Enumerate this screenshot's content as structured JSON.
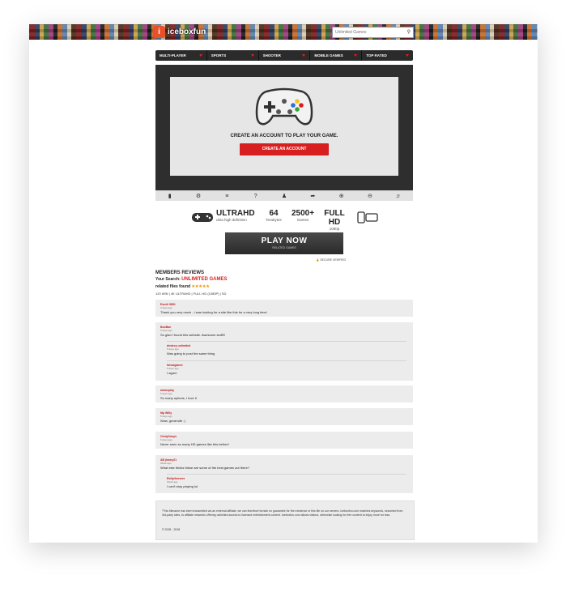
{
  "header": {
    "logo_text": "iceboxfun",
    "search_placeholder": "Unlimited Games"
  },
  "nav": {
    "items": [
      {
        "label": "MULTI-PLAYER"
      },
      {
        "label": "SPORTS"
      },
      {
        "label": "SHOOTER"
      },
      {
        "label": "MOBILE GAMES"
      },
      {
        "label": "TOP RATED"
      }
    ]
  },
  "player": {
    "prompt": "CREATE AN ACCOUNT TO PLAY YOUR GAME.",
    "create_button": "CREATE AN ACCOUNT",
    "controls": [
      "gamepad-icon",
      "gear-icon",
      "sliders-icon",
      "help-icon",
      "users-icon",
      "share-icon",
      "zoom-in-icon",
      "zoom-out-icon",
      "volume-icon"
    ]
  },
  "features": {
    "ultrahd_title": "ULTRAHD",
    "ultrahd_sub": "ultra high definition",
    "tb_value": "64",
    "tb_label": "Terabytes",
    "games_value": "2500+",
    "games_label": "Games",
    "fullhd_value": "FULL HD",
    "fullhd_label": "1080p"
  },
  "playnow": {
    "title": "PLAY NOW",
    "subtitle": "RELATED GAMES",
    "secure": "SECURE VERIFIED"
  },
  "reviews": {
    "title": "MEMBERS REVIEWS",
    "search_label": "Your Search:",
    "search_keyword": "UNLIMITED GAMES",
    "found_label": "related files found",
    "stars": "★★★★★",
    "tags": "120 WIN | 4K ULTRAHD | FULL HD (1080P) | SD"
  },
  "comments": [
    {
      "name": "Excell 98St",
      "date": "3 days ago",
      "text": "Thank you very much - i was looking for a site like this for a very long time!"
    },
    {
      "name": "BoxBan",
      "date": "5 days ago",
      "text": "So glad I found this website. Awesome stuff!!!"
    },
    {
      "name": "destroy unlimited",
      "date": "5 days ago",
      "text": "Was going to post the same thing"
    },
    {
      "name": "Newdgamer",
      "date": "5 days ago",
      "text": "I agree"
    },
    {
      "name": "animeplay",
      "date": "5 days ago",
      "text": "So many options, I love it"
    },
    {
      "name": "Mp Willy",
      "date": "5 days ago",
      "text": "Wow, great site :)"
    },
    {
      "name": "CindyCasys",
      "date": "6 days ago",
      "text": "Never seen so many HD games like this before!"
    },
    {
      "name": "AB jimmy21",
      "date": "Week ago",
      "text": "What else thinks these are some of the best games out there?"
    },
    {
      "name": "Rollythecreer",
      "date": "Week ago",
      "text": "I can't stop playing lol"
    }
  ],
  "footer": {
    "disclaimer": "*This filename has been transmitted via an external affiliate, we can therefore furnish no guarantee for the existence of this file on our servers. Iceboxfun.com matches keywords, searched from 3rd-party sites, to affiliate networks offering unlimited access to licensed entertainment content. Iceboxfun.com allows visitors, otherwise looking for free content to enjoy more for less.",
    "copyright": "© 2005 - 2018"
  },
  "colors": {
    "accent": "#d81f1f",
    "nav_bg": "#2b2b2b",
    "player_bg": "#2e2e2e"
  }
}
